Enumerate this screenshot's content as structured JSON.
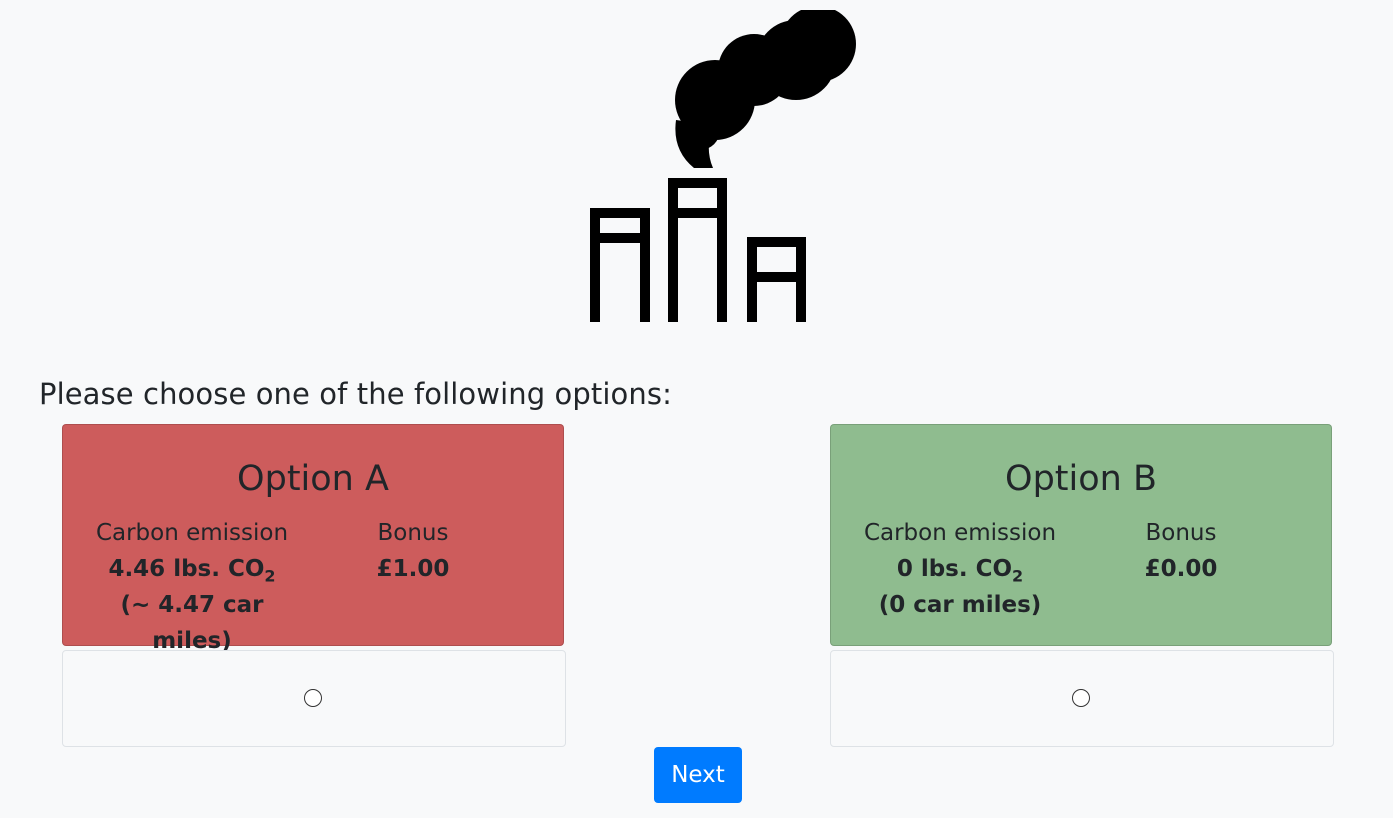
{
  "prompt": "Please choose one of the following options:",
  "options": [
    {
      "title": "Option A",
      "emission_label": "Carbon emission",
      "emission_value": "4.46 lbs. CO",
      "emission_sub": "2",
      "emission_miles": "(~ 4.47 car miles)",
      "bonus_label": "Bonus",
      "bonus_value": "£1.00",
      "color": "#cd5c5c"
    },
    {
      "title": "Option B",
      "emission_label": "Carbon emission",
      "emission_value": "0 lbs. CO",
      "emission_sub": "2",
      "emission_miles": "(0 car miles)",
      "bonus_label": "Bonus",
      "bonus_value": "£0.00",
      "color": "#8fbc8f"
    }
  ],
  "next_label": "Next",
  "icons": {
    "factory": "factory-smoke-icon"
  }
}
